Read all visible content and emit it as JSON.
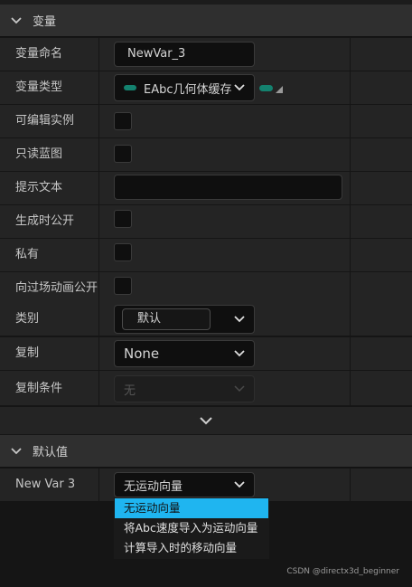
{
  "sections": {
    "variable": {
      "title": "变量"
    },
    "default_value": {
      "title": "默认值"
    }
  },
  "fields": {
    "name": {
      "label": "变量命名",
      "value": "NewVar_3"
    },
    "type": {
      "label": "变量类型",
      "value": "EAbc几何体缓存"
    },
    "instance_editable": {
      "label": "可编辑实例"
    },
    "blueprint_readonly": {
      "label": "只读蓝图"
    },
    "tooltip": {
      "label": "提示文本",
      "value": ""
    },
    "expose_on_spawn": {
      "label": "生成时公开"
    },
    "private": {
      "label": "私有"
    },
    "expose_cinematics": {
      "label": "向过场动画公开"
    },
    "category": {
      "label": "类别",
      "value": "默认"
    },
    "replication": {
      "label": "复制",
      "value": "None"
    },
    "replication_condition": {
      "label": "复制条件",
      "value": "无"
    }
  },
  "default": {
    "label": "New Var 3",
    "value": "无运动向量",
    "options": [
      "无运动向量",
      "将Abc速度导入为运动向量",
      "计算导入时的移动向量"
    ],
    "selected_index": 0
  },
  "watermark": "CSDN @directx3d_beginner",
  "colors": {
    "accent_selection": "#1fb5f0",
    "type_pill": "#14826f"
  },
  "icons": {
    "section_toggle": "chevron-down-icon",
    "combo_arrow": "chevron-down-icon",
    "advanced_expand": "chevron-down-icon"
  }
}
